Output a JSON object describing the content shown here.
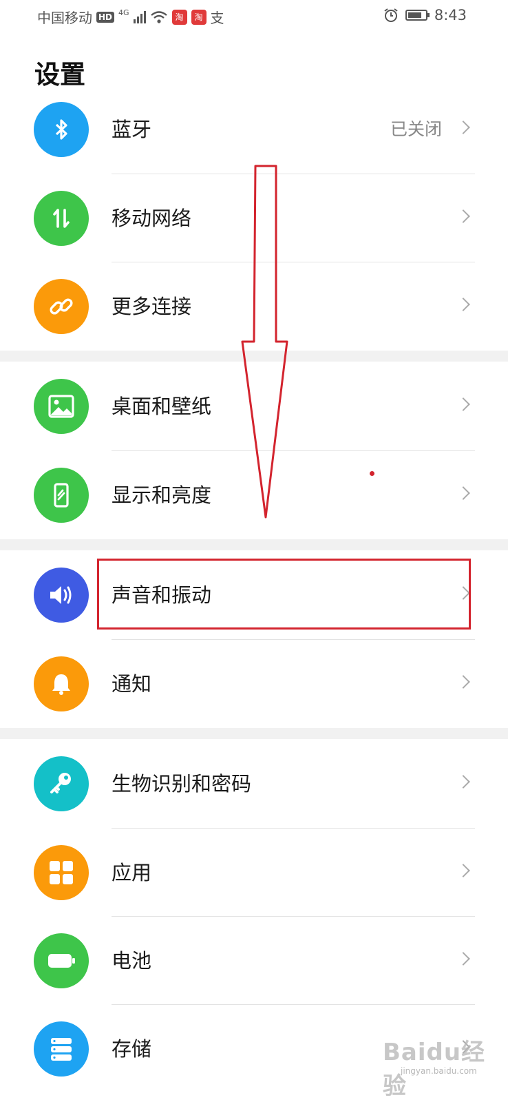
{
  "status_bar": {
    "carrier": "中国移动",
    "hd": "HD",
    "network": "4G",
    "app1": "淘",
    "app2": "淘",
    "pay": "支",
    "time": "8:43",
    "battery_level_percent": 80
  },
  "title": "设置",
  "settings": [
    {
      "label": "蓝牙",
      "value": "已关闭",
      "icon": "bluetooth-icon",
      "color": "#1ea3f2"
    },
    {
      "label": "移动网络",
      "value": "",
      "icon": "mobile-data-icon",
      "color": "#3ec54a"
    },
    {
      "label": "更多连接",
      "value": "",
      "icon": "link-icon",
      "color": "#fb9a0a"
    },
    {
      "label": "桌面和壁纸",
      "value": "",
      "icon": "wallpaper-icon",
      "color": "#3ec54a"
    },
    {
      "label": "显示和亮度",
      "value": "",
      "icon": "display-icon",
      "color": "#3ec54a"
    },
    {
      "label": "声音和振动",
      "value": "",
      "icon": "sound-icon",
      "color": "#3f5be3"
    },
    {
      "label": "通知",
      "value": "",
      "icon": "bell-icon",
      "color": "#fb9a0a"
    },
    {
      "label": "生物识别和密码",
      "value": "",
      "icon": "key-icon",
      "color": "#14c0c8"
    },
    {
      "label": "应用",
      "value": "",
      "icon": "apps-icon",
      "color": "#fb9a0a"
    },
    {
      "label": "电池",
      "value": "",
      "icon": "battery-icon",
      "color": "#3ec54a"
    },
    {
      "label": "存储",
      "value": "",
      "icon": "storage-icon",
      "color": "#1ea3f2"
    }
  ],
  "annotation_color": "#d3242e",
  "watermark": {
    "brand": "Baidu经验",
    "url": "jingyan.baidu.com"
  }
}
